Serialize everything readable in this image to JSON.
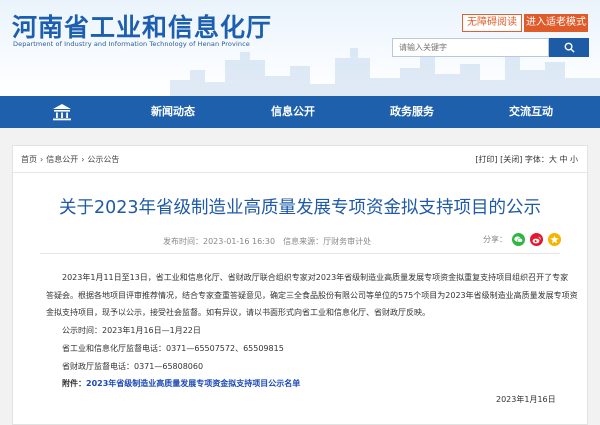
{
  "header": {
    "site_title": "河南省工业和信息化厅",
    "site_subtitle": "Department of Industry and Information Technology of Henan Province",
    "accessibility_label": "无障碍阅读",
    "elder_mode_label": "进入适老模式",
    "search_placeholder": "请输入关键字"
  },
  "nav": {
    "items": [
      "新闻动态",
      "信息公开",
      "政务服务",
      "交流互动"
    ]
  },
  "breadcrumb": [
    "首页",
    "信息公开",
    "公示公告"
  ],
  "tools": {
    "print": "[打印]",
    "close": "[关闭]",
    "font_label": "字体：",
    "large": "大",
    "medium": "中",
    "small": "小"
  },
  "article": {
    "title": "关于2023年省级制造业高质量发展专项资金拟支持项目的公示",
    "publish_time": "发布时间：2023-01-16 16:30",
    "source": "信息来源：厅财务审计处",
    "share_label": "分享：",
    "paragraph_1_line_1": "2023年1月11日至13日，省工业和信息化厅、省财政厅联合组织专家对2023年省级制造业高质量发展专项资金拟重复支持项目组织召开了专家",
    "paragraph_1_line_2": "答疑会。根据各地项目评审推荐情况，结合专家查重答疑意见，确定三全食品股份有限公司等单位的575个项目为2023年省级制造业高质量发展专项资",
    "paragraph_1_line_3": "金拟支持项目，现予以公示，接受社会监督。如有异议，请以书面形式向省工业和信息化厅、省财政厅反映。",
    "notice_period": "公示时间：2023年1月16日—1月22日",
    "phone_1": "省工业和信息化厅监督电话：0371—65507572、65509815",
    "phone_2": "省财政厅监督电话：0371—65808060",
    "attachment_label": "附件：",
    "attachment_link": "2023年省级制造业高质量发展专项资金拟支持项目公示名单",
    "sign_date": "2023年1月16日"
  },
  "colors": {
    "brand_blue": "#1e60ab",
    "title_blue": "#1f5aa6",
    "orange": "#e05b2a",
    "wechat_green": "#2fb542",
    "weibo_red": "#e6162d",
    "qzone_yellow": "#f5b400"
  }
}
